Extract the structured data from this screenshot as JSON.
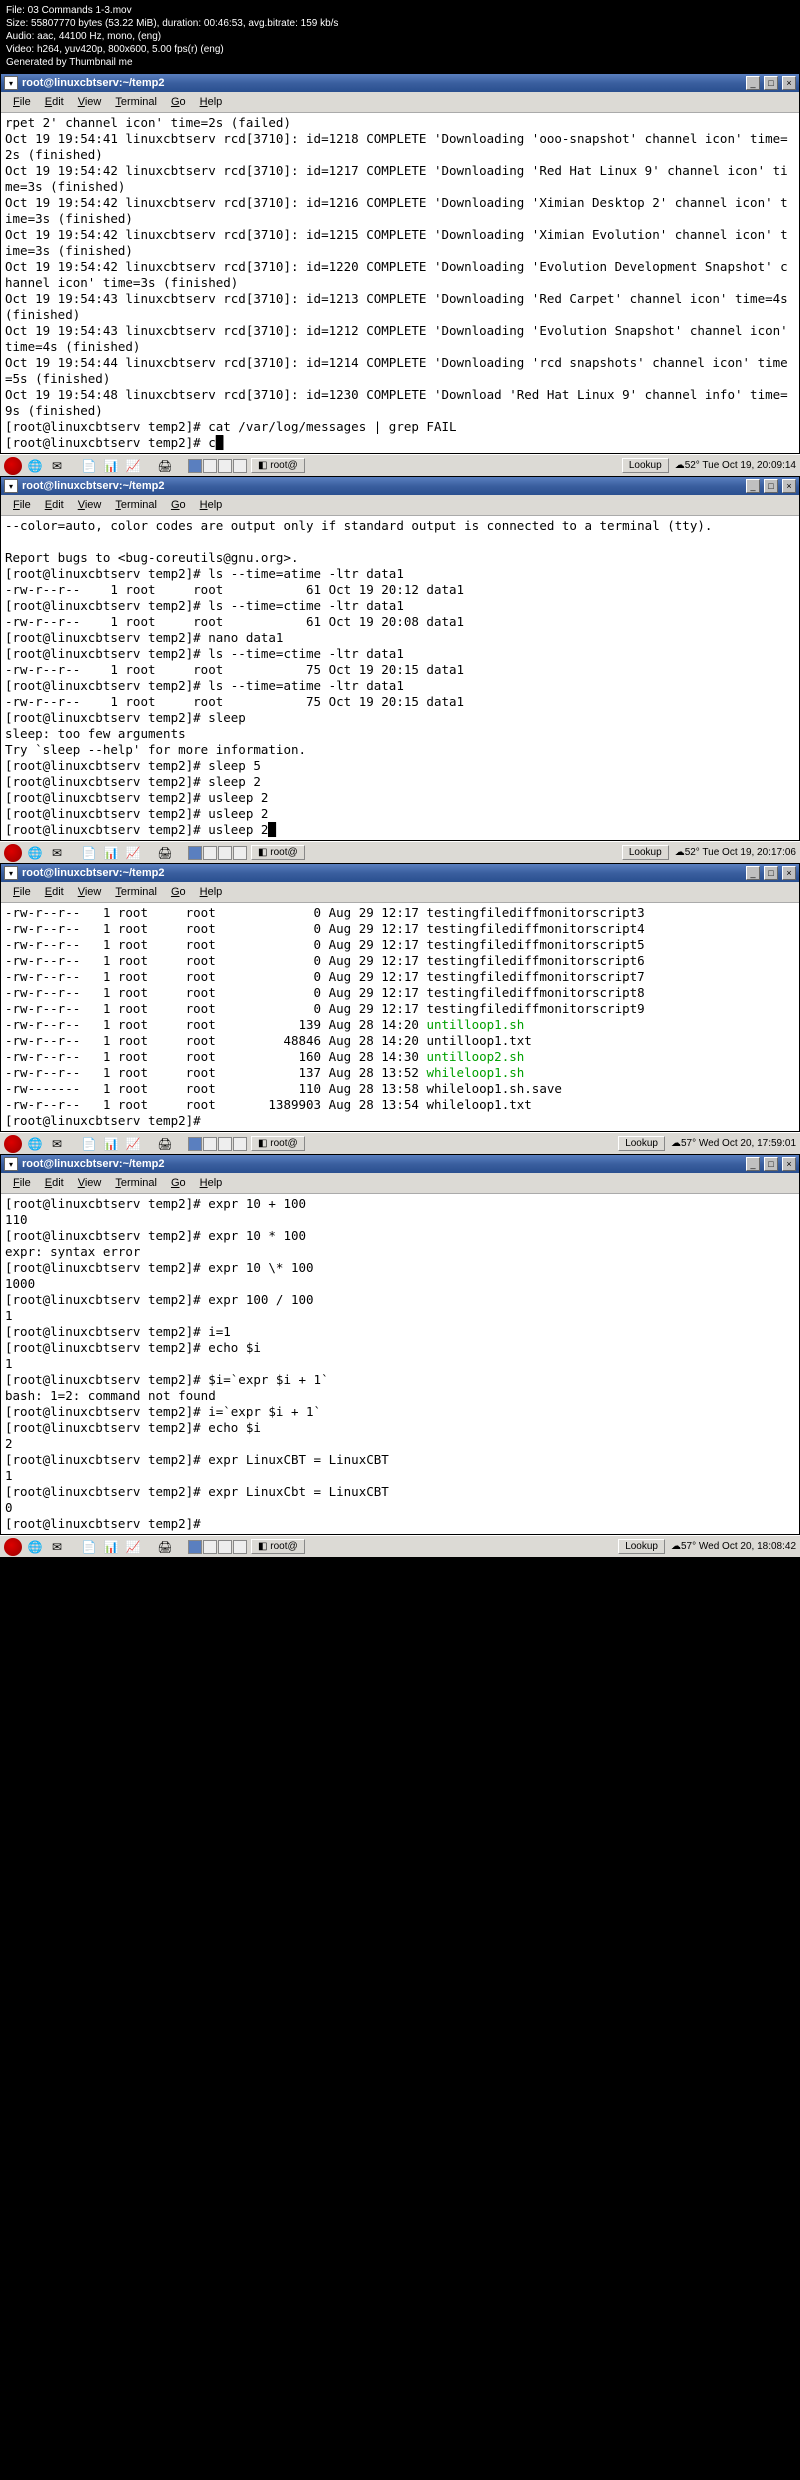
{
  "meta": {
    "file": "File: 03 Commands 1-3.mov",
    "size": "Size: 55807770 bytes (53.22 MiB), duration: 00:46:53, avg.bitrate: 159 kb/s",
    "audio": "Audio: aac, 44100 Hz, mono, (eng)",
    "video": "Video: h264, yuv420p, 800x600, 5.00 fps(r) (eng)",
    "gen": "Generated by Thumbnail me"
  },
  "menus": {
    "file": "File",
    "edit": "Edit",
    "view": "View",
    "terminal": "Terminal",
    "go": "Go",
    "help": "Help"
  },
  "title": "root@linuxcbtserv:~/temp2",
  "btns": {
    "min": "_",
    "max": "□",
    "close": "×"
  },
  "taskbar": {
    "root_label": "root@",
    "lookup": "Lookup",
    "weather1": "☁52° Tue Oct 19, 20:09:14",
    "weather2": "☁52° Tue Oct 19, 20:17:06",
    "weather3": "☁57° Wed Oct 20, 17:59:01",
    "weather4": "☁57° Wed Oct 20, 18:08:42"
  },
  "term1": "rpet 2' channel icon' time=2s (failed)\nOct 19 19:54:41 linuxcbtserv rcd[3710]: id=1218 COMPLETE 'Downloading 'ooo-snapshot' channel icon' time=2s (finished)\nOct 19 19:54:42 linuxcbtserv rcd[3710]: id=1217 COMPLETE 'Downloading 'Red Hat Linux 9' channel icon' time=3s (finished)\nOct 19 19:54:42 linuxcbtserv rcd[3710]: id=1216 COMPLETE 'Downloading 'Ximian Desktop 2' channel icon' time=3s (finished)\nOct 19 19:54:42 linuxcbtserv rcd[3710]: id=1215 COMPLETE 'Downloading 'Ximian Evolution' channel icon' time=3s (finished)\nOct 19 19:54:42 linuxcbtserv rcd[3710]: id=1220 COMPLETE 'Downloading 'Evolution Development Snapshot' channel icon' time=3s (finished)\nOct 19 19:54:43 linuxcbtserv rcd[3710]: id=1213 COMPLETE 'Downloading 'Red Carpet' channel icon' time=4s (finished)\nOct 19 19:54:43 linuxcbtserv rcd[3710]: id=1212 COMPLETE 'Downloading 'Evolution Snapshot' channel icon' time=4s (finished)\nOct 19 19:54:44 linuxcbtserv rcd[3710]: id=1214 COMPLETE 'Downloading 'rcd snapshots' channel icon' time=5s (finished)\nOct 19 19:54:48 linuxcbtserv rcd[3710]: id=1230 COMPLETE 'Download 'Red Hat Linux 9' channel info' time=9s (finished)\n[root@linuxcbtserv temp2]# cat /var/log/messages | grep FAIL\n[root@linuxcbtserv temp2]# c",
  "term2": "--color=auto, color codes are output only if standard output is connected to a terminal (tty).\n\nReport bugs to <bug-coreutils@gnu.org>.\n[root@linuxcbtserv temp2]# ls --time=atime -ltr data1\n-rw-r--r--    1 root     root           61 Oct 19 20:12 data1\n[root@linuxcbtserv temp2]# ls --time=ctime -ltr data1\n-rw-r--r--    1 root     root           61 Oct 19 20:08 data1\n[root@linuxcbtserv temp2]# nano data1\n[root@linuxcbtserv temp2]# ls --time=ctime -ltr data1\n-rw-r--r--    1 root     root           75 Oct 19 20:15 data1\n[root@linuxcbtserv temp2]# ls --time=atime -ltr data1\n-rw-r--r--    1 root     root           75 Oct 19 20:15 data1\n[root@linuxcbtserv temp2]# sleep\nsleep: too few arguments\nTry `sleep --help' for more information.\n[root@linuxcbtserv temp2]# sleep 5\n[root@linuxcbtserv temp2]# sleep 2\n[root@linuxcbtserv temp2]# usleep 2\n[root@linuxcbtserv temp2]# usleep 2\n[root@linuxcbtserv temp2]# usleep 2",
  "term3_rows": [
    {
      "perm": "-rw-r--r--",
      "n": "1",
      "o": "root",
      "g": "root",
      "sz": "0",
      "dt": "Aug 29 12:17",
      "f": "testingfilediffmonitorscript3",
      "c": ""
    },
    {
      "perm": "-rw-r--r--",
      "n": "1",
      "o": "root",
      "g": "root",
      "sz": "0",
      "dt": "Aug 29 12:17",
      "f": "testingfilediffmonitorscript4",
      "c": ""
    },
    {
      "perm": "-rw-r--r--",
      "n": "1",
      "o": "root",
      "g": "root",
      "sz": "0",
      "dt": "Aug 29 12:17",
      "f": "testingfilediffmonitorscript5",
      "c": ""
    },
    {
      "perm": "-rw-r--r--",
      "n": "1",
      "o": "root",
      "g": "root",
      "sz": "0",
      "dt": "Aug 29 12:17",
      "f": "testingfilediffmonitorscript6",
      "c": ""
    },
    {
      "perm": "-rw-r--r--",
      "n": "1",
      "o": "root",
      "g": "root",
      "sz": "0",
      "dt": "Aug 29 12:17",
      "f": "testingfilediffmonitorscript7",
      "c": ""
    },
    {
      "perm": "-rw-r--r--",
      "n": "1",
      "o": "root",
      "g": "root",
      "sz": "0",
      "dt": "Aug 29 12:17",
      "f": "testingfilediffmonitorscript8",
      "c": ""
    },
    {
      "perm": "-rw-r--r--",
      "n": "1",
      "o": "root",
      "g": "root",
      "sz": "0",
      "dt": "Aug 29 12:17",
      "f": "testingfilediffmonitorscript9",
      "c": ""
    },
    {
      "perm": "-rw-r--r--",
      "n": "1",
      "o": "root",
      "g": "root",
      "sz": "139",
      "dt": "Aug 28 14:20",
      "f": "untilloop1.sh",
      "c": "g"
    },
    {
      "perm": "-rw-r--r--",
      "n": "1",
      "o": "root",
      "g": "root",
      "sz": "48846",
      "dt": "Aug 28 14:20",
      "f": "untilloop1.txt",
      "c": ""
    },
    {
      "perm": "-rw-r--r--",
      "n": "1",
      "o": "root",
      "g": "root",
      "sz": "160",
      "dt": "Aug 28 14:30",
      "f": "untilloop2.sh",
      "c": "g"
    },
    {
      "perm": "-rw-r--r--",
      "n": "1",
      "o": "root",
      "g": "root",
      "sz": "137",
      "dt": "Aug 28 13:52",
      "f": "whileloop1.sh",
      "c": "g"
    },
    {
      "perm": "-rw-------",
      "n": "1",
      "o": "root",
      "g": "root",
      "sz": "110",
      "dt": "Aug 28 13:58",
      "f": "whileloop1.sh.save",
      "c": ""
    },
    {
      "perm": "-rw-r--r--",
      "n": "1",
      "o": "root",
      "g": "root",
      "sz": "1389903",
      "dt": "Aug 28 13:54",
      "f": "whileloop1.txt",
      "c": ""
    }
  ],
  "term3_prompt": "[root@linuxcbtserv temp2]#",
  "term4": "[root@linuxcbtserv temp2]# expr 10 + 100\n110\n[root@linuxcbtserv temp2]# expr 10 * 100\nexpr: syntax error\n[root@linuxcbtserv temp2]# expr 10 \\* 100\n1000\n[root@linuxcbtserv temp2]# expr 100 / 100\n1\n[root@linuxcbtserv temp2]# i=1\n[root@linuxcbtserv temp2]# echo $i\n1\n[root@linuxcbtserv temp2]# $i=`expr $i + 1`\nbash: 1=2: command not found\n[root@linuxcbtserv temp2]# i=`expr $i + 1`\n[root@linuxcbtserv temp2]# echo $i\n2\n[root@linuxcbtserv temp2]# expr LinuxCBT = LinuxCBT\n1\n[root@linuxcbtserv temp2]# expr LinuxCbt = LinuxCBT\n0\n[root@linuxcbtserv temp2]# "
}
